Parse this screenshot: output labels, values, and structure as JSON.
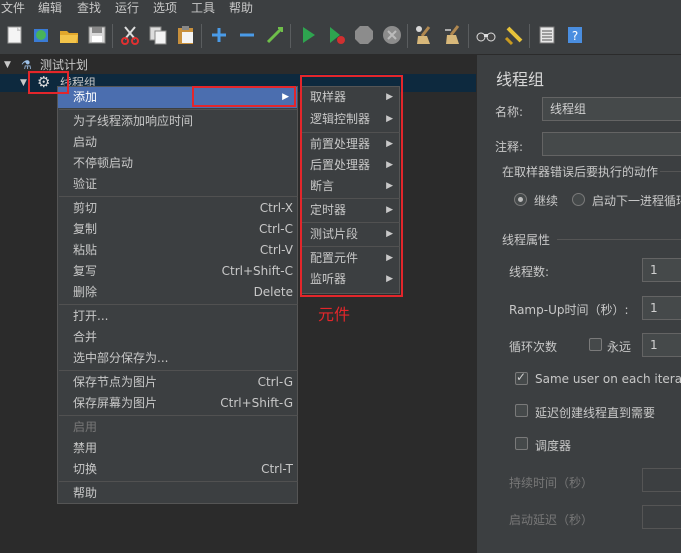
{
  "menubar": [
    "文件",
    "编辑",
    "查找",
    "运行",
    "选项",
    "工具",
    "帮助"
  ],
  "toolbar": {
    "icons": [
      "new-icon",
      "template-icon",
      "open-icon",
      "save-icon",
      "cut-icon",
      "copy-icon",
      "paste-icon",
      "expand-icon",
      "collapse-icon",
      "toggle-icon",
      "start-icon",
      "start-no-pause-icon",
      "stop-icon",
      "shutdown-icon",
      "clear-icon",
      "clear-all-icon",
      "search-icon",
      "reset-search-icon",
      "function-helper-icon",
      "help-icon"
    ]
  },
  "tree": {
    "root": "测试计划",
    "child": "线程组"
  },
  "context_menu": {
    "items": [
      {
        "label": "添加",
        "shortcut": "",
        "submenu": true,
        "highlight": true
      },
      {
        "label": "为子线程添加响应时间",
        "shortcut": ""
      },
      {
        "label": "启动",
        "shortcut": ""
      },
      {
        "label": "不停顿启动",
        "shortcut": ""
      },
      {
        "label": "验证",
        "shortcut": ""
      },
      {
        "label": "剪切",
        "shortcut": "Ctrl-X"
      },
      {
        "label": "复制",
        "shortcut": "Ctrl-C"
      },
      {
        "label": "粘贴",
        "shortcut": "Ctrl-V"
      },
      {
        "label": "复写",
        "shortcut": "Ctrl+Shift-C"
      },
      {
        "label": "删除",
        "shortcut": "Delete"
      },
      {
        "label": "打开...",
        "shortcut": ""
      },
      {
        "label": "合并",
        "shortcut": ""
      },
      {
        "label": "选中部分保存为...",
        "shortcut": ""
      },
      {
        "label": "保存节点为图片",
        "shortcut": "Ctrl-G"
      },
      {
        "label": "保存屏幕为图片",
        "shortcut": "Ctrl+Shift-G"
      },
      {
        "label": "启用",
        "shortcut": "",
        "disabled": true
      },
      {
        "label": "禁用",
        "shortcut": ""
      },
      {
        "label": "切换",
        "shortcut": "Ctrl-T"
      },
      {
        "label": "帮助",
        "shortcut": ""
      }
    ]
  },
  "submenu": {
    "items": [
      "取样器",
      "逻辑控制器",
      "前置处理器",
      "后置处理器",
      "断言",
      "定时器",
      "测试片段",
      "配置元件",
      "监听器"
    ]
  },
  "annotation": "元件",
  "panel": {
    "title": "线程组",
    "name_label": "名称:",
    "name_value": "线程组",
    "comment_label": "注释:",
    "error_action_title": "在取样器错误后要执行的动作",
    "opt_continue": "继续",
    "opt_next_loop": "启动下一进程循环",
    "thread_props_title": "线程属性",
    "threads_label": "线程数:",
    "threads_value": "1",
    "rampup_label": "Ramp-Up时间（秒）:",
    "rampup_value": "1",
    "loop_label": "循环次数",
    "forever_label": "永远",
    "loop_value": "1",
    "same_user_label": "Same user on each iteration",
    "delay_create_label": "延迟创建线程直到需要",
    "scheduler_label": "调度器",
    "duration_label": "持续时间（秒）",
    "startup_delay_label": "启动延迟（秒）"
  }
}
